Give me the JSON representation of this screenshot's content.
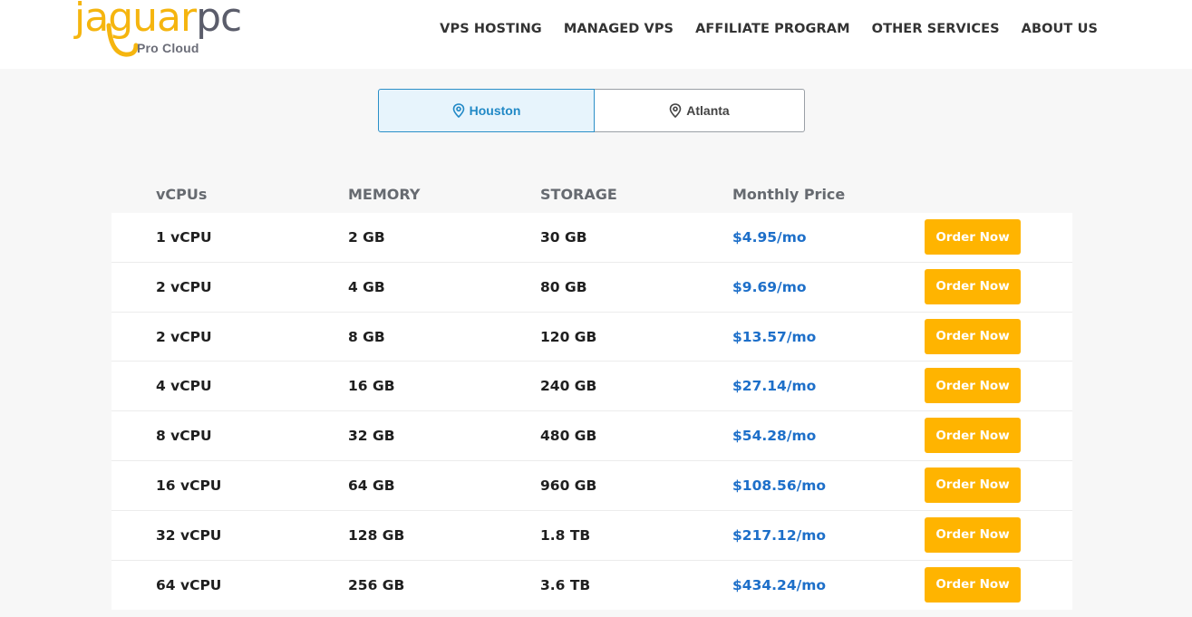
{
  "brand": {
    "logo_word_a": "jaguar",
    "logo_word_b": "pc",
    "tagline": "Pro Cloud",
    "accent": "#f5b50f"
  },
  "nav": {
    "items": [
      "VPS HOSTING",
      "MANAGED VPS",
      "AFFILIATE PROGRAM",
      "OTHER SERVICES",
      "ABOUT US"
    ]
  },
  "locations": {
    "selected": "Houston",
    "tabs": [
      {
        "label": "Houston",
        "icon": "map-pin-icon"
      },
      {
        "label": "Atlanta",
        "icon": "map-pin-icon"
      }
    ]
  },
  "table": {
    "headers": [
      "vCPUs",
      "MEMORY",
      "STORAGE",
      "Monthly Price"
    ],
    "rows": [
      {
        "vcpu": "1 vCPU",
        "memory": "2 GB",
        "storage": "30 GB",
        "price": "$4.95/mo"
      },
      {
        "vcpu": "2 vCPU",
        "memory": "4 GB",
        "storage": "80 GB",
        "price": "$9.69/mo"
      },
      {
        "vcpu": "2 vCPU",
        "memory": "8 GB",
        "storage": "120 GB",
        "price": "$13.57/mo"
      },
      {
        "vcpu": "4 vCPU",
        "memory": "16 GB",
        "storage": "240 GB",
        "price": "$27.14/mo"
      },
      {
        "vcpu": "8 vCPU",
        "memory": "32 GB",
        "storage": "480 GB",
        "price": "$54.28/mo"
      },
      {
        "vcpu": "16 vCPU",
        "memory": "64 GB",
        "storage": "960 GB",
        "price": "$108.56/mo"
      },
      {
        "vcpu": "32 vCPU",
        "memory": "128 GB",
        "storage": "1.8 TB",
        "price": "$217.12/mo"
      },
      {
        "vcpu": "64 vCPU",
        "memory": "256 GB",
        "storage": "3.6 TB",
        "price": "$434.24/mo"
      }
    ],
    "order_label": "Order Now"
  },
  "colors": {
    "price": "#1d6fc9",
    "button": "#ffb400",
    "active_tab_bg": "#e7f4fc",
    "active_tab_text": "#2189c6"
  }
}
